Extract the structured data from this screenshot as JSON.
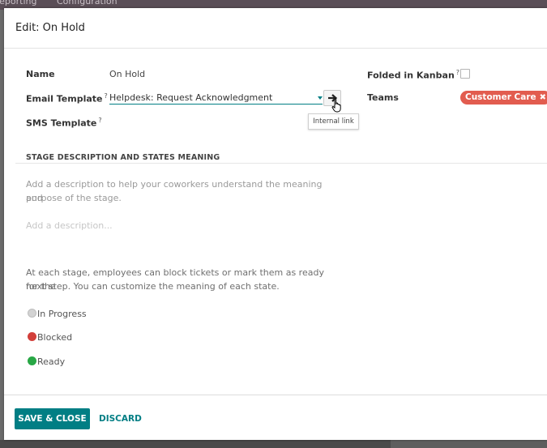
{
  "background": {
    "menu_items": [
      "Reporting",
      "Configuration"
    ]
  },
  "dialog": {
    "title": "Edit: On Hold"
  },
  "form": {
    "name_label": "Name",
    "name_value": "On Hold",
    "email_template_label": "Email Template",
    "email_template_value": "Helpdesk: Request Acknowledgment",
    "sms_template_label": "SMS Template",
    "help_marker": "?",
    "internal_link_tooltip": "Internal link",
    "folded_label": "Folded in Kanban",
    "folded_checked": false,
    "teams_label": "Teams",
    "teams_tags": [
      "Customer Care"
    ]
  },
  "section": {
    "title": "STAGE DESCRIPTION AND STATES MEANING",
    "help_line1": "Add a description to help your coworkers understand the meaning and",
    "help_line2": "purpose of the stage.",
    "description_placeholder": "Add a description...",
    "states_help_line1": "At each stage, employees can block tickets or mark them as ready for the",
    "states_help_line2": "next step. You can customize the meaning of each state.",
    "states": [
      {
        "label": "In Progress",
        "color": "#d3d3d3"
      },
      {
        "label": "Blocked",
        "color": "#d23f3a"
      },
      {
        "label": "Ready",
        "color": "#28a745"
      }
    ]
  },
  "footer": {
    "save_label": "SAVE & CLOSE",
    "discard_label": "DISCARD"
  },
  "colors": {
    "primary": "#017e84",
    "tag": "#e25c4f"
  }
}
